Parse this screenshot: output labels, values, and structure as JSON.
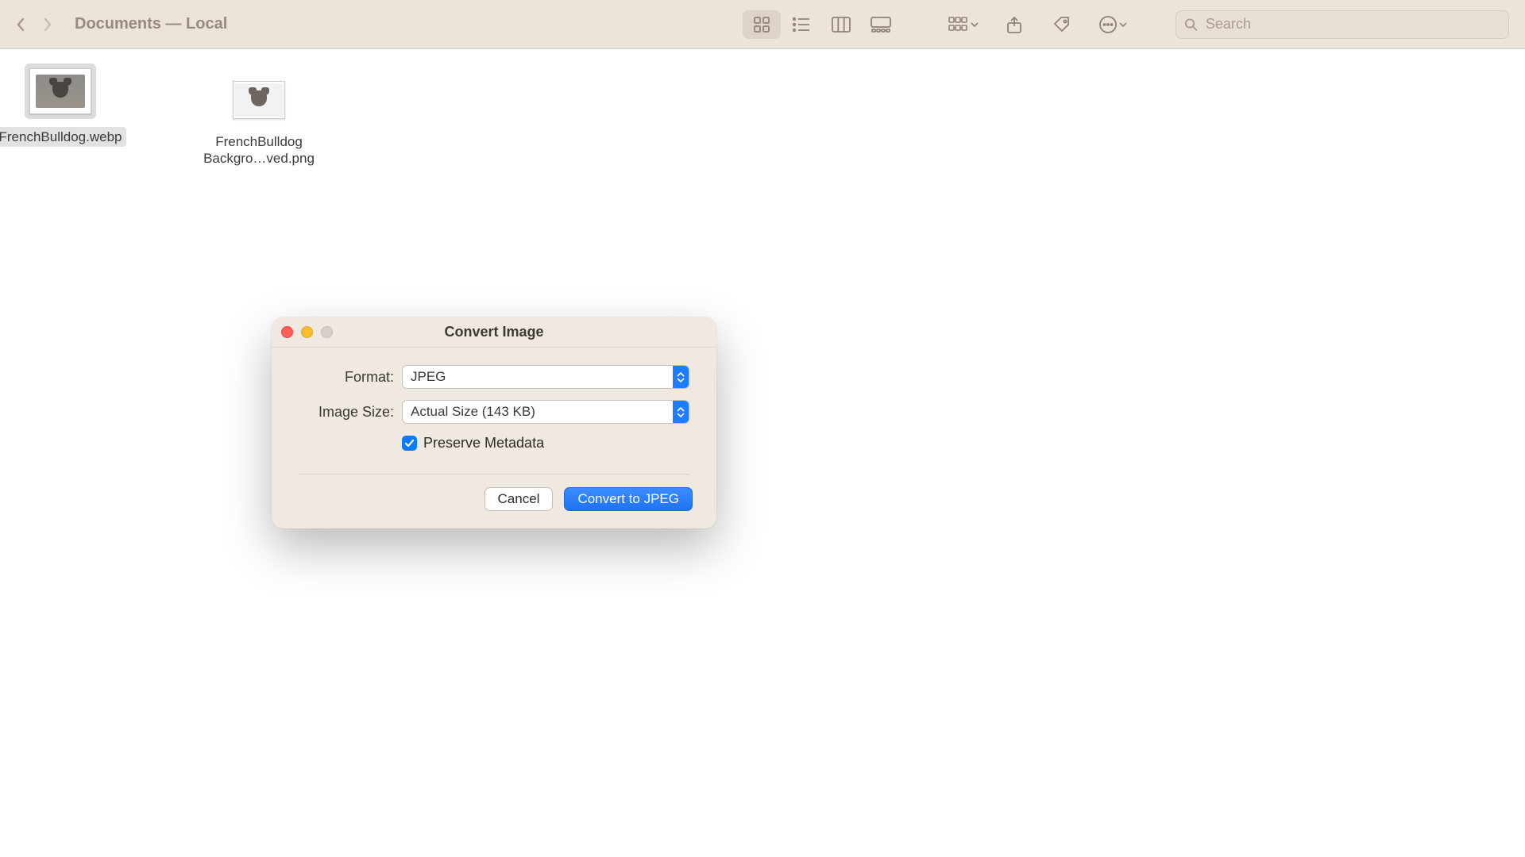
{
  "toolbar": {
    "title": "Documents — Local",
    "search_placeholder": "Search"
  },
  "files": [
    {
      "name": "FrenchBulldog.webp",
      "selected": true
    },
    {
      "name": "FrenchBulldog Backgro…ved.png",
      "selected": false
    }
  ],
  "dialog": {
    "title": "Convert Image",
    "format_label": "Format:",
    "format_value": "JPEG",
    "size_label": "Image Size:",
    "size_value": "Actual Size (143 KB)",
    "preserve_metadata_label": "Preserve Metadata",
    "preserve_metadata_checked": true,
    "cancel_label": "Cancel",
    "convert_label": "Convert to JPEG"
  }
}
